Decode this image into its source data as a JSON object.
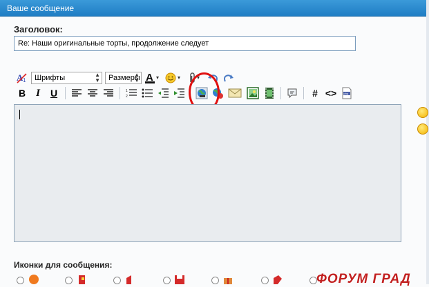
{
  "window": {
    "title": "Ваше сообщение"
  },
  "subject": {
    "label": "Заголовок:",
    "value": "Re: Наши оригинальные торты, продолжение следует"
  },
  "toolbar": {
    "font_select": "Шрифты",
    "size_select": "Размеры",
    "bold": "B",
    "italic": "I",
    "underline": "U"
  },
  "icons_section": {
    "label": "Иконки для сообщения:"
  },
  "watermark": "ФОРУМ ГРАД"
}
